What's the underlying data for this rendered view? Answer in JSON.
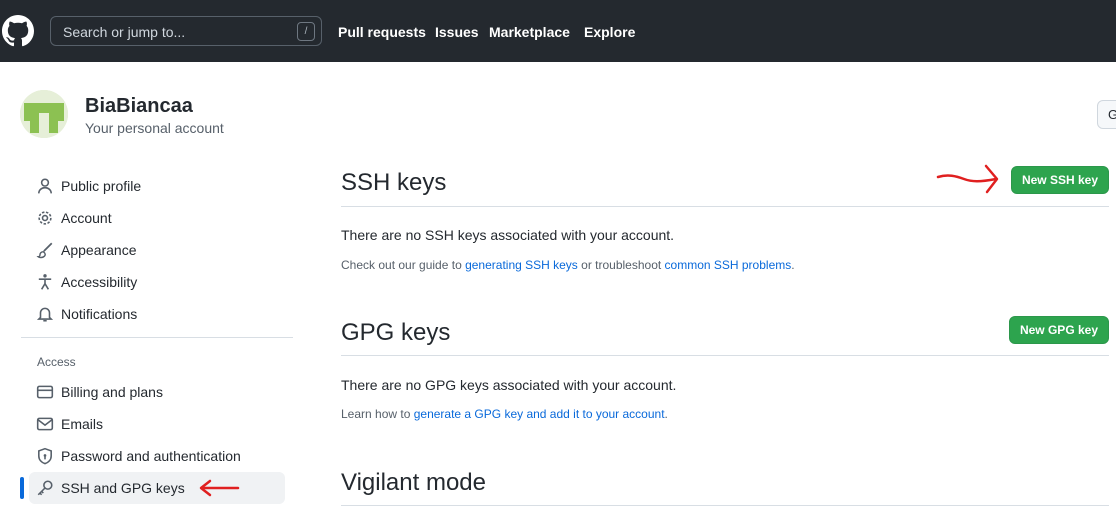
{
  "header": {
    "search_placeholder": "Search or jump to...",
    "search_shortcut": "/",
    "nav": [
      "Pull requests",
      "Issues",
      "Marketplace",
      "Explore"
    ]
  },
  "account": {
    "name": "BiaBiancaa",
    "subtitle": "Your personal account",
    "right_button": "G"
  },
  "sidebar": {
    "items": [
      {
        "label": "Public profile",
        "icon": "person-icon"
      },
      {
        "label": "Account",
        "icon": "gear-icon"
      },
      {
        "label": "Appearance",
        "icon": "paintbrush-icon"
      },
      {
        "label": "Accessibility",
        "icon": "accessibility-icon"
      },
      {
        "label": "Notifications",
        "icon": "bell-icon"
      }
    ],
    "access_heading": "Access",
    "access_items": [
      {
        "label": "Billing and plans",
        "icon": "credit-card-icon"
      },
      {
        "label": "Emails",
        "icon": "mail-icon"
      },
      {
        "label": "Password and authentication",
        "icon": "shield-icon"
      },
      {
        "label": "SSH and GPG keys",
        "icon": "key-icon",
        "selected": true
      }
    ]
  },
  "main": {
    "ssh": {
      "title": "SSH keys",
      "button": "New SSH key",
      "empty": "There are no SSH keys associated with your account.",
      "help_prefix": "Check out our guide to ",
      "help_link1": "generating SSH keys",
      "help_middle": " or troubleshoot ",
      "help_link2": "common SSH problems",
      "help_suffix": "."
    },
    "gpg": {
      "title": "GPG keys",
      "button": "New GPG key",
      "empty": "There are no GPG keys associated with your account.",
      "help_prefix": "Learn how to ",
      "help_link": "generate a GPG key and add it to your account",
      "help_suffix": "."
    },
    "vigilant": {
      "title": "Vigilant mode"
    }
  },
  "colors": {
    "header_bg": "#24292f",
    "accent_blue": "#0969da",
    "button_green": "#2da44e",
    "annotation_red": "#e02020"
  }
}
